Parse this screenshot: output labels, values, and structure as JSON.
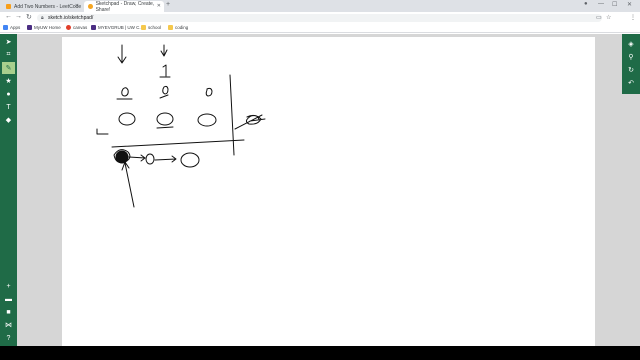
{
  "tabs": [
    {
      "title": "Add Two Numbers - LeetCode",
      "active": false
    },
    {
      "title": "Sketchpad - Draw, Create, Share!",
      "active": true
    }
  ],
  "address": {
    "url": "sketch.io/sketchpad/"
  },
  "bookmarks": [
    {
      "label": "Apps",
      "icon": "apps-grid-icon",
      "color": "#4285f4"
    },
    {
      "label": "MyUW Home",
      "icon": "uw-icon",
      "color": "#4b2e83"
    },
    {
      "label": "canvas",
      "icon": "canvas-icon",
      "color": "#e13f2b"
    },
    {
      "label": "MYEVGRUB | UW C...",
      "icon": "uw-icon",
      "color": "#4b2e83"
    },
    {
      "label": "school",
      "icon": "folder-icon",
      "color": "#f5c84c"
    },
    {
      "label": "coding",
      "icon": "folder-icon",
      "color": "#f5c84c"
    }
  ],
  "left_tools": [
    {
      "name": "select-tool",
      "icon": "cursor-icon",
      "glyph": "➤"
    },
    {
      "name": "crop-tool",
      "icon": "crop-icon",
      "glyph": "⌗"
    },
    {
      "name": "pen-tool",
      "icon": "pencil-icon",
      "glyph": "✎",
      "active": true
    },
    {
      "name": "stamp-tool",
      "icon": "star-icon",
      "glyph": "★"
    },
    {
      "name": "shape-tool",
      "icon": "circle-icon",
      "glyph": "●"
    },
    {
      "name": "text-tool",
      "icon": "text-icon",
      "glyph": "T"
    },
    {
      "name": "fill-tool",
      "icon": "bucket-icon",
      "glyph": "◆"
    }
  ],
  "left_tools_bottom": [
    {
      "name": "add-tool",
      "icon": "plus-icon",
      "glyph": "+"
    },
    {
      "name": "open-tool",
      "icon": "folder-icon",
      "glyph": "▬"
    },
    {
      "name": "save-tool",
      "icon": "save-icon",
      "glyph": "■"
    },
    {
      "name": "share-tool",
      "icon": "share-icon",
      "glyph": "⋈"
    },
    {
      "name": "help-tool",
      "icon": "help-icon",
      "glyph": "?"
    }
  ],
  "right_tools": [
    {
      "name": "layers-tool",
      "icon": "layers-icon",
      "glyph": "◈"
    },
    {
      "name": "zoom-tool",
      "icon": "search-icon",
      "glyph": "⚲"
    },
    {
      "name": "history-tool",
      "icon": "history-icon",
      "glyph": "↻"
    },
    {
      "name": "undo-tool",
      "icon": "undo-icon",
      "glyph": "↶"
    }
  ],
  "colors": {
    "toolbar_green": "#1f6b47",
    "active_tool": "#a8d08d",
    "chrome_tabstrip": "#dee1e6"
  }
}
